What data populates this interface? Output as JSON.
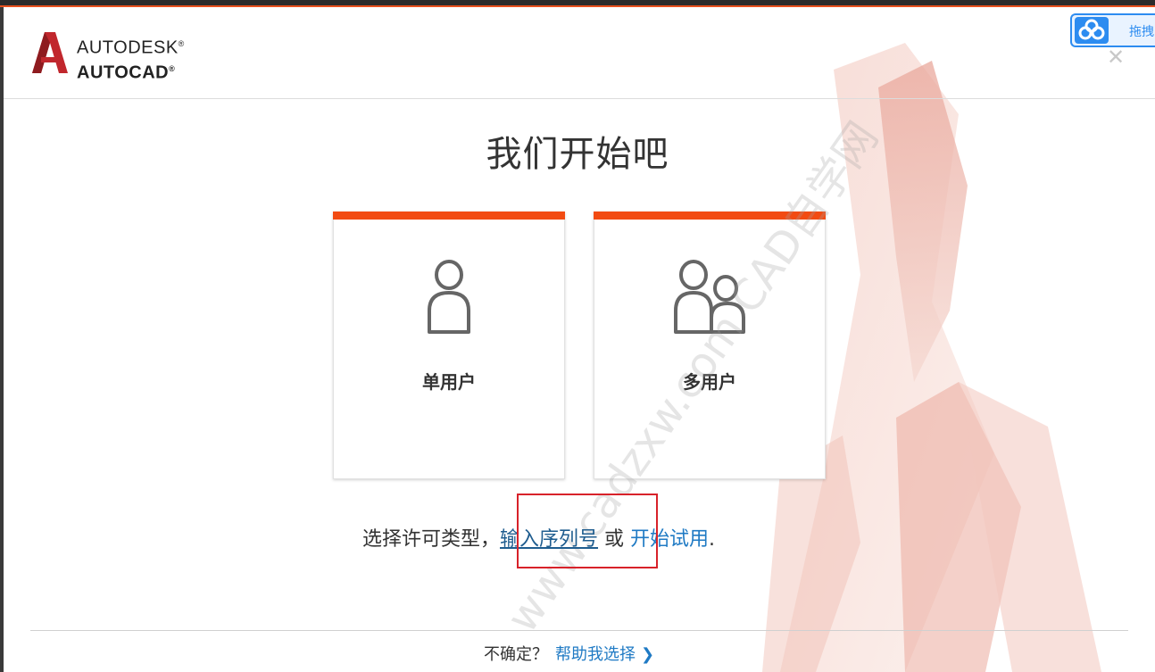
{
  "brand": {
    "line1": "AUTODESK",
    "line2": "AUTOCAD",
    "reg1": "®",
    "reg2": "®",
    "accent_color": "#f24b12"
  },
  "window": {
    "close_icon": "close-icon"
  },
  "float_widget": {
    "label": "拖拽",
    "icon": "baidu-cloud-icon"
  },
  "title": "我们开始吧",
  "cards": [
    {
      "label": "单用户",
      "icon": "single-user-icon"
    },
    {
      "label": "多用户",
      "icon": "multi-user-icon"
    }
  ],
  "prompt": {
    "prefix": "选择许可类型，",
    "serial_link": "输入序列号",
    "or": " 或 ",
    "trial_link": "开始试用",
    "suffix": "."
  },
  "footer": {
    "question": "不确定？",
    "help_link": "帮助我选择",
    "chevron_icon": "chevron-right-icon"
  },
  "watermark": "www.cadzxw.com CAD自学网"
}
